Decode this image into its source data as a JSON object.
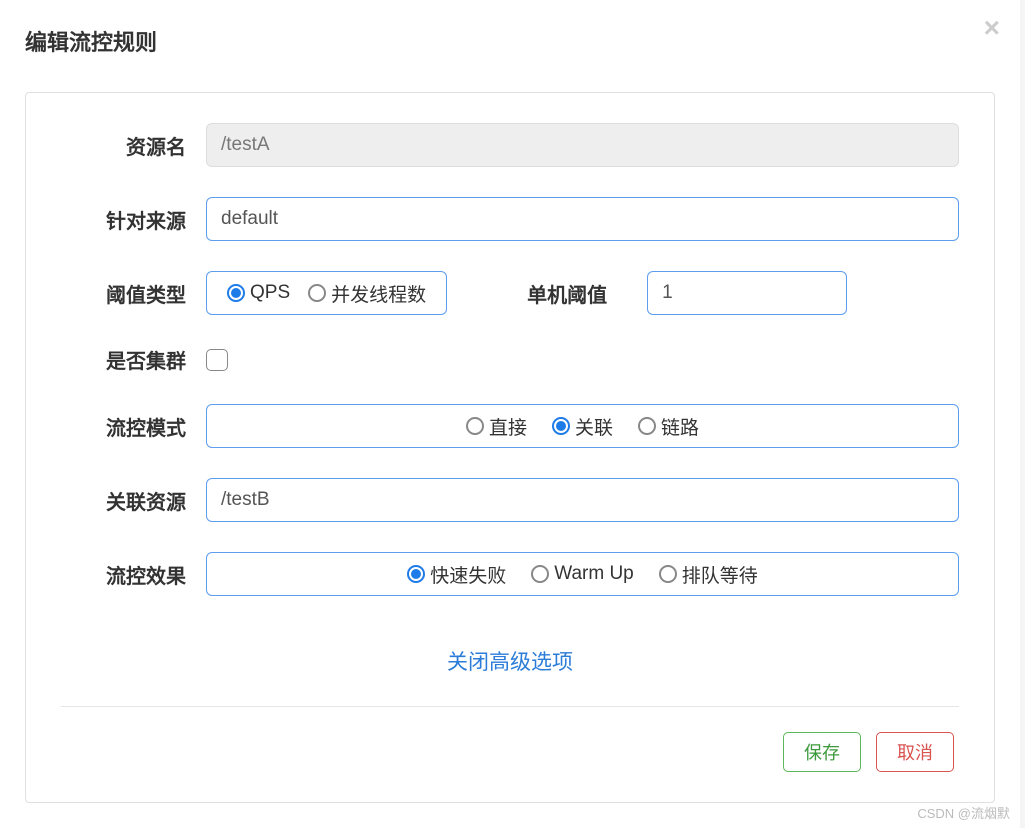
{
  "modal": {
    "title": "编辑流控规则",
    "close_label": "×"
  },
  "form": {
    "resource_name": {
      "label": "资源名",
      "value": "/testA"
    },
    "source": {
      "label": "针对来源",
      "value": "default"
    },
    "threshold_type": {
      "label": "阈值类型",
      "options": {
        "qps": "QPS",
        "thread": "并发线程数"
      },
      "selected": "qps"
    },
    "single_threshold": {
      "label": "单机阈值",
      "value": "1"
    },
    "cluster": {
      "label": "是否集群",
      "checked": false
    },
    "flow_mode": {
      "label": "流控模式",
      "options": {
        "direct": "直接",
        "relate": "关联",
        "chain": "链路"
      },
      "selected": "relate"
    },
    "related_resource": {
      "label": "关联资源",
      "value": "/testB"
    },
    "flow_effect": {
      "label": "流控效果",
      "options": {
        "fast_fail": "快速失败",
        "warm_up": "Warm Up",
        "queue": "排队等待"
      },
      "selected": "fast_fail"
    }
  },
  "advanced": {
    "toggle_label": "关闭高级选项"
  },
  "footer": {
    "save": "保存",
    "cancel": "取消"
  },
  "watermark": "CSDN @流烟默"
}
